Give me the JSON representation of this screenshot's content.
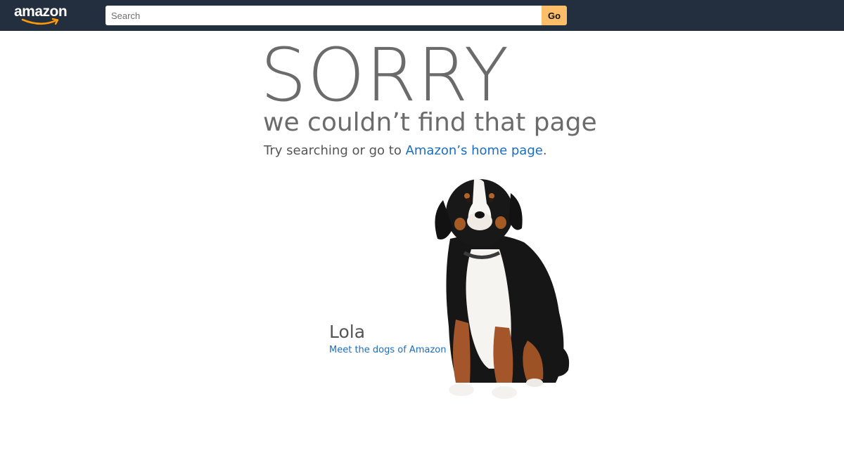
{
  "header": {
    "logo_text": "amazon",
    "search": {
      "placeholder": "Search",
      "value": ""
    },
    "go_label": "Go"
  },
  "main": {
    "headline": "SORRY",
    "subtitle": "we couldn’t find that page",
    "try_text": "Try searching or go to ",
    "home_link": "Amazon’s home page",
    "try_suffix": ".",
    "dog_name": "Lola",
    "dogs_link": "Meet the dogs of Amazon"
  },
  "colors": {
    "nav_bg": "#232f3e",
    "go_button": "#febd69",
    "link": "#1a6ebf",
    "text_gray": "#6b6b6b",
    "logo_smile": "#ff9900"
  },
  "icons": [
    "amazon-smile-logo",
    "dog-illustration"
  ]
}
